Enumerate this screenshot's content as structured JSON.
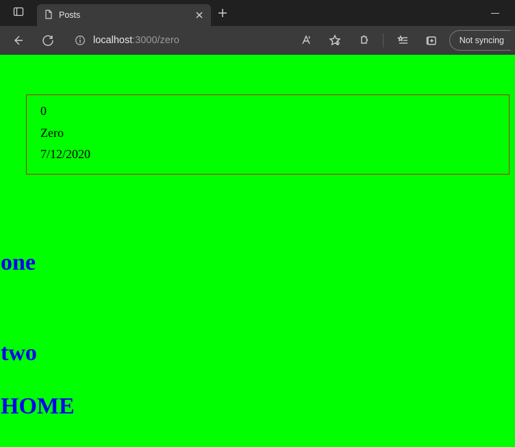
{
  "browser": {
    "tab_title": "Posts",
    "url_host": "localhost",
    "url_port_path": ":3000/zero",
    "sync_label": "Not syncing"
  },
  "page": {
    "card": {
      "id": "0",
      "title": "Zero",
      "date": "7/12/2020"
    },
    "links": {
      "one": "one",
      "two": "two",
      "home": "HOME"
    }
  }
}
